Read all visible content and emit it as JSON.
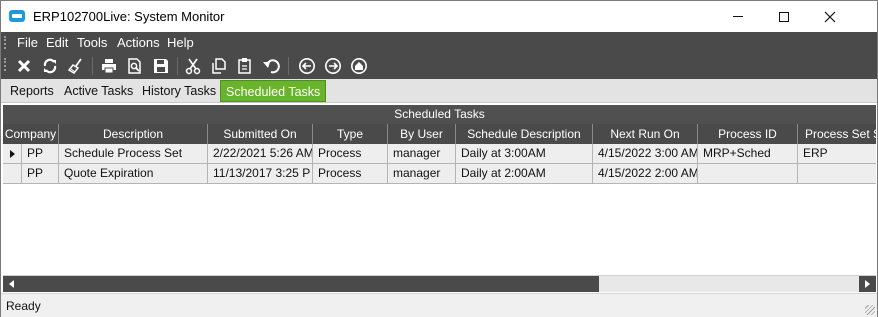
{
  "window": {
    "title": "ERP102700Live: System Monitor"
  },
  "menu": [
    "File",
    "Edit",
    "Tools",
    "Actions",
    "Help"
  ],
  "toolbar": {
    "icons": [
      "delete-icon",
      "refresh-icon",
      "clear-icon",
      "print-icon",
      "print-preview-icon",
      "save-icon",
      "cut-icon",
      "copy-icon",
      "paste-icon",
      "undo-icon",
      "back-icon",
      "forward-icon",
      "home-icon"
    ]
  },
  "tabs": [
    {
      "label": "Reports"
    },
    {
      "label": "Active Tasks"
    },
    {
      "label": "History Tasks"
    },
    {
      "label": "Scheduled Tasks",
      "active": true
    }
  ],
  "grid": {
    "title": "Scheduled Tasks",
    "columns": [
      "Company",
      "Description",
      "Submitted On",
      "Type",
      "By User",
      "Schedule Description",
      "Next Run On",
      "Process ID",
      "Process Set S"
    ],
    "rows": [
      [
        "PP",
        "Schedule Process Set",
        "2/22/2021 5:26 AM",
        "Process",
        "manager",
        "Daily at 3:00AM",
        "4/15/2022 3:00 AM",
        "MRP+Sched",
        "ERP"
      ],
      [
        "PP",
        "Quote Expiration",
        "11/13/2017 3:25 P",
        "Process",
        "manager",
        "Daily at 2:00AM",
        "4/15/2022 2:00 AM",
        "",
        ""
      ]
    ],
    "current_row": 0
  },
  "scrollbar": {
    "horizontal_position": 0,
    "visible_fraction": 0.69
  },
  "status": {
    "text": "Ready"
  },
  "colors": {
    "dark_bar": "#4a4a4a",
    "active_tab": "#6ab42d",
    "row_bg": "#eeeeee",
    "app_icon": "#1e9bd7"
  }
}
